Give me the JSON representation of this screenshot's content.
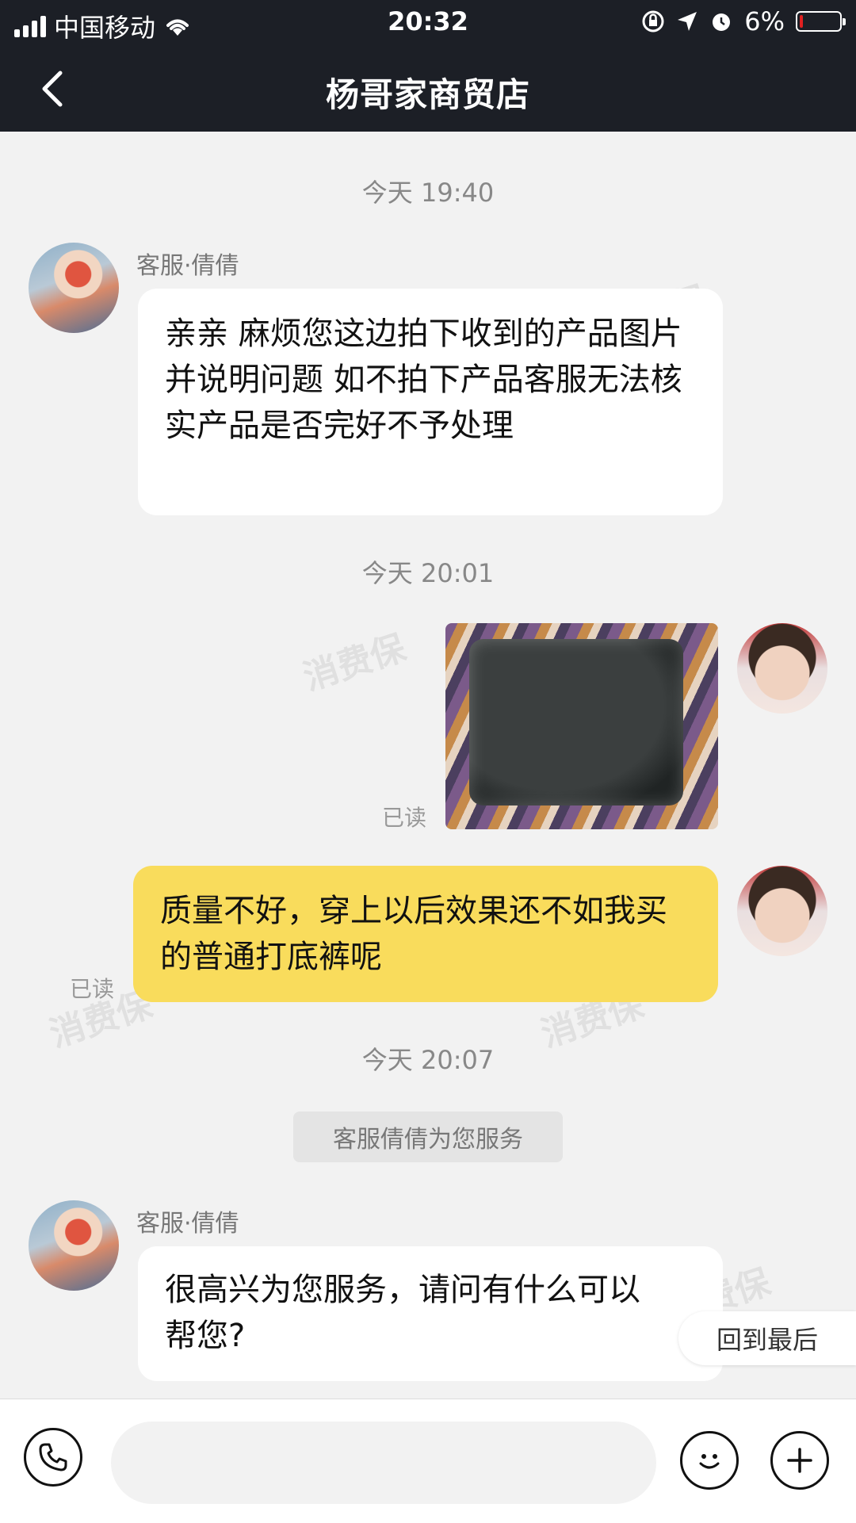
{
  "status_bar": {
    "carrier": "中国移动",
    "time": "20:32",
    "battery": "6%",
    "battery_fraction": 0.06,
    "battery_color": "#e02020"
  },
  "nav": {
    "title": "杨哥家商贸店",
    "back_icon": "chevron-left-icon"
  },
  "messages": {
    "ts1": "今天 19:40",
    "agent_name_1": "客服·倩倩",
    "agent_msg_1": "亲亲 麻烦您这边拍下收到的产品图片并说明问题 如不拍下产品客服无法核实产品是否完好不予处理",
    "ts2": "今天 20:01",
    "read_1": "已读",
    "user_msg_1": "质量不好，穿上以后效果还不如我买的普通打底裤呢",
    "read_2": "已读",
    "ts3": "今天 20:07",
    "system_notice": "客服倩倩为您服务",
    "agent_name_2": "客服·倩倩",
    "agent_msg_2": "很高兴为您服务，请问有什么可以帮您?"
  },
  "jump_to_latest": "回到最后",
  "bottom_bar": {
    "phone_icon": "phone-icon",
    "emoji_icon": "smiley-icon",
    "add_icon": "plus-icon"
  },
  "colors": {
    "header_bg": "#1c1f26",
    "user_bubble": "#f9dc5c",
    "agent_bubble": "#ffffff",
    "chat_bg": "#f2f2f2"
  },
  "watermark": "消费保"
}
